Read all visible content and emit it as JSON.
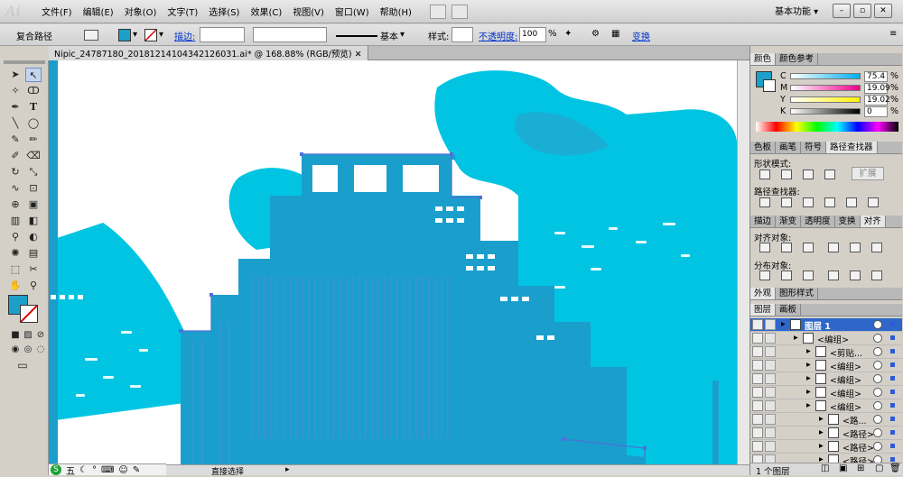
{
  "app": {
    "logo": "Ai"
  },
  "menu": [
    "文件(F)",
    "编辑(E)",
    "对象(O)",
    "文字(T)",
    "选择(S)",
    "效果(C)",
    "视图(V)",
    "窗口(W)",
    "帮助(H)"
  ],
  "workspace": "基本功能",
  "window_controls": {
    "minimize": "–",
    "restore": "▫",
    "close": "✕"
  },
  "control_bar": {
    "selection_type": "复合路径",
    "stroke_label": "描边:",
    "brush_label": "基本",
    "style_label": "样式:",
    "opacity_label": "不透明度:",
    "opacity_value": "100",
    "opacity_unit": "%",
    "transform_label": "变换"
  },
  "document_tab": "Nipic_24787180_20181214104342126031.ai* @ 168.88% (RGB/预览)",
  "status": {
    "zoom": "168.88%",
    "tool": "直接选择"
  },
  "taskbar": {
    "ime": "五"
  },
  "colors": {
    "fill": "#1ca0c9",
    "cyan": "#00c4e2",
    "blue": "#1a9fcc",
    "accent_blue": "#4f6fd9"
  },
  "panels": {
    "color": {
      "tabs": [
        "颜色",
        "颜色参考"
      ],
      "channels": [
        {
          "name": "C",
          "value": "75.4"
        },
        {
          "name": "M",
          "value": "19.09"
        },
        {
          "name": "Y",
          "value": "19.02"
        },
        {
          "name": "K",
          "value": "0"
        }
      ],
      "unit": "%"
    },
    "pathfinder": {
      "tabs": [
        "色板",
        "画笔",
        "符号",
        "路径查找器"
      ],
      "shape_modes_label": "形状模式:",
      "expand_button": "扩展",
      "pathfinders_label": "路径查找器:"
    },
    "align": {
      "tabs": [
        "描边",
        "渐变",
        "透明度",
        "变换",
        "对齐"
      ],
      "align_objects_label": "对齐对象:",
      "distribute_objects_label": "分布对象:"
    },
    "appearance": {
      "tabs": [
        "外观",
        "图形样式"
      ]
    },
    "layers": {
      "tabs": [
        "图层",
        "画板"
      ],
      "rows": [
        {
          "name": "图层 1",
          "selected": true
        },
        {
          "name": "<编组>"
        },
        {
          "name": "<剪贴..."
        },
        {
          "name": "<编组>"
        },
        {
          "name": "<编组>"
        },
        {
          "name": "<编组>"
        },
        {
          "name": "<编组>"
        },
        {
          "name": "<路..."
        },
        {
          "name": "<路径>"
        },
        {
          "name": "<路径>"
        },
        {
          "name": "<路径>"
        }
      ],
      "count": "1 个图层"
    }
  }
}
